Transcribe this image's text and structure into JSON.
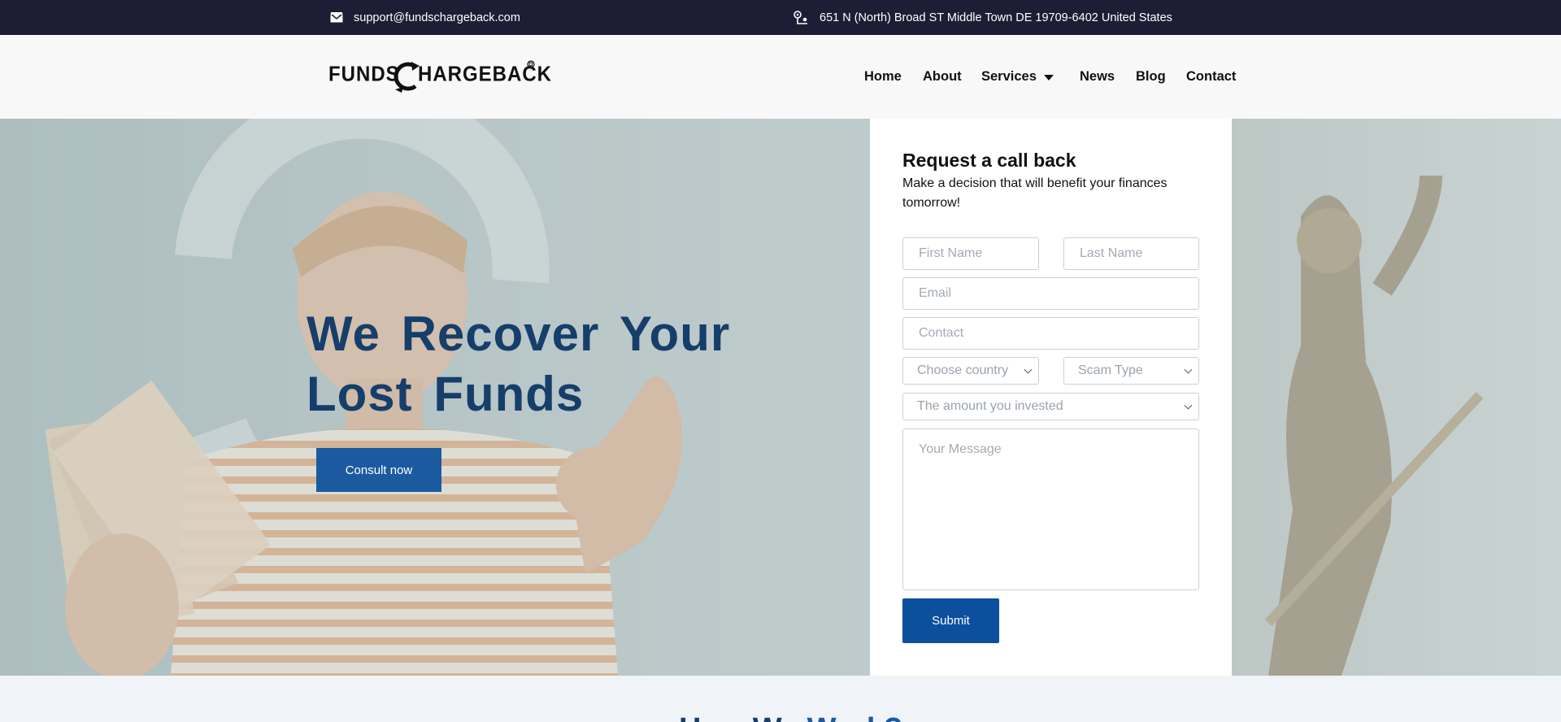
{
  "topbar": {
    "email": "support@fundschargeback.com",
    "address": "651 N (North) Broad ST Middle Town DE 19709-6402 United States",
    "email_icon": "envelope-icon",
    "address_icon": "location-pin-icon"
  },
  "header": {
    "logo_left": "FUNDS",
    "logo_right": "HARGEBACK",
    "nav": [
      {
        "label": "Home"
      },
      {
        "label": "About"
      },
      {
        "label": "Services"
      },
      {
        "label": "News"
      },
      {
        "label": "Blog"
      },
      {
        "label": "Contact"
      }
    ]
  },
  "hero": {
    "title": "We Recover Your Lost Funds",
    "cta": "Consult now"
  },
  "form": {
    "title": "Request a call back",
    "subtitle": "Make a decision that will benefit your finances tomorrow!",
    "first_name_placeholder": "First Name",
    "last_name_placeholder": "Last Name",
    "email_placeholder": "Email",
    "contact_placeholder": "Contact",
    "country_selected": "Choose country",
    "scam_selected": "Scam Type",
    "amount_selected": "The amount you invested",
    "message_placeholder": "Your Message",
    "submit_label": "Submit"
  },
  "section": {
    "heading_start": "How We",
    "heading_accent": "Work?"
  },
  "colors": {
    "topbar_bg": "#1f1d35",
    "brand_blue": "#0c4f9c",
    "title_blue": "#163e6a"
  }
}
